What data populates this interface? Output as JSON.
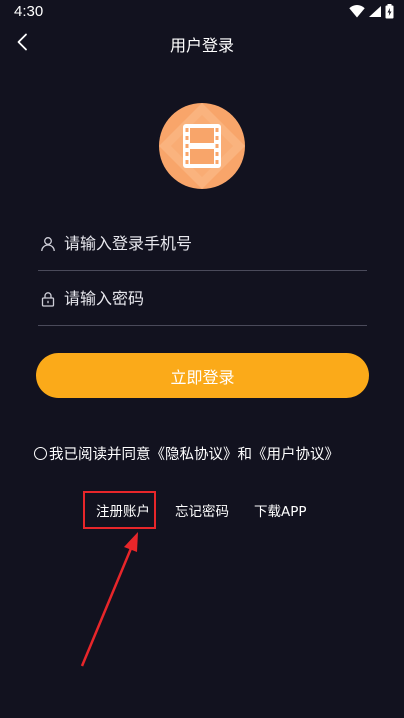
{
  "status_bar": {
    "time": "4:30"
  },
  "nav": {
    "title": "用户登录",
    "back_icon": "chevron-left-icon"
  },
  "logo": {
    "icon": "film-icon",
    "color": "#f8a56a"
  },
  "form": {
    "phone_placeholder": "请输入登录手机号",
    "password_placeholder": "请输入密码",
    "login_label": "立即登录"
  },
  "agreement": {
    "prefix": "我已阅读并同意",
    "privacy": "《隐私协议》",
    "and": "和",
    "user": "《用户协议》"
  },
  "links": {
    "register": "注册账户",
    "forgot": "忘记密码",
    "download": "下载APP"
  },
  "colors": {
    "background": "#12121f",
    "accent": "#fbaa19",
    "annotation": "#e8262a"
  }
}
